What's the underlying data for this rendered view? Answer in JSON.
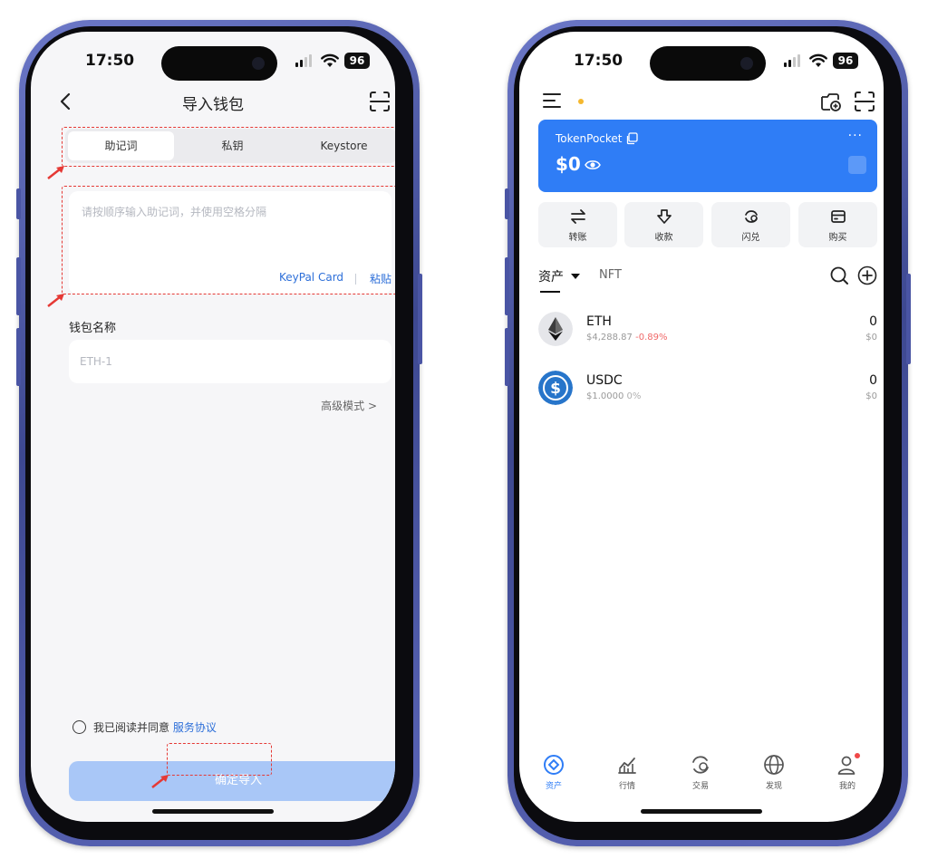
{
  "status_bar": {
    "time": "17:50",
    "battery": "96"
  },
  "left_screen": {
    "header": {
      "title": "导入钱包",
      "back_icon": "chevron-left-icon",
      "scan_icon": "scan-icon"
    },
    "tabs": [
      {
        "label": "助记词",
        "active": true
      },
      {
        "label": "私钥",
        "active": false
      },
      {
        "label": "Keystore",
        "active": false
      }
    ],
    "mnemonic": {
      "placeholder": "请按顺序输入助记词，并使用空格分隔",
      "keypal_label": "KeyPal Card",
      "paste_label": "粘贴"
    },
    "wallet_name": {
      "label": "钱包名称",
      "placeholder": "ETH-1"
    },
    "advanced_label": "高级模式 >",
    "agreement": {
      "text": "我已阅读并同意",
      "link": "服务协议"
    },
    "confirm_label": "确定导入",
    "highlight_color": "#e53935"
  },
  "right_screen": {
    "wallet_card": {
      "name": "TokenPocket",
      "balance": "$0",
      "more": "···",
      "color": "#2f7df6"
    },
    "actions": [
      {
        "label": "转账",
        "icon": "transfer-icon"
      },
      {
        "label": "收款",
        "icon": "receive-icon"
      },
      {
        "label": "闪兑",
        "icon": "swap-icon"
      },
      {
        "label": "购买",
        "icon": "buy-card-icon"
      }
    ],
    "asset_tabs": {
      "assets": "资产",
      "nft": "NFT"
    },
    "tokens": [
      {
        "symbol": "ETH",
        "price": "$4,288.87",
        "change": "-0.89%",
        "amount": "0",
        "value": "$0"
      },
      {
        "symbol": "USDC",
        "price": "$1.0000",
        "change": "0%",
        "amount": "0",
        "value": "$0"
      }
    ],
    "bottom_nav": [
      {
        "label": "资产",
        "icon": "assets-icon",
        "active": true
      },
      {
        "label": "行情",
        "icon": "market-icon",
        "active": false
      },
      {
        "label": "交易",
        "icon": "trade-icon",
        "active": false
      },
      {
        "label": "发现",
        "icon": "discover-globe-icon",
        "active": false
      },
      {
        "label": "我的",
        "icon": "profile-icon",
        "active": false
      }
    ]
  }
}
